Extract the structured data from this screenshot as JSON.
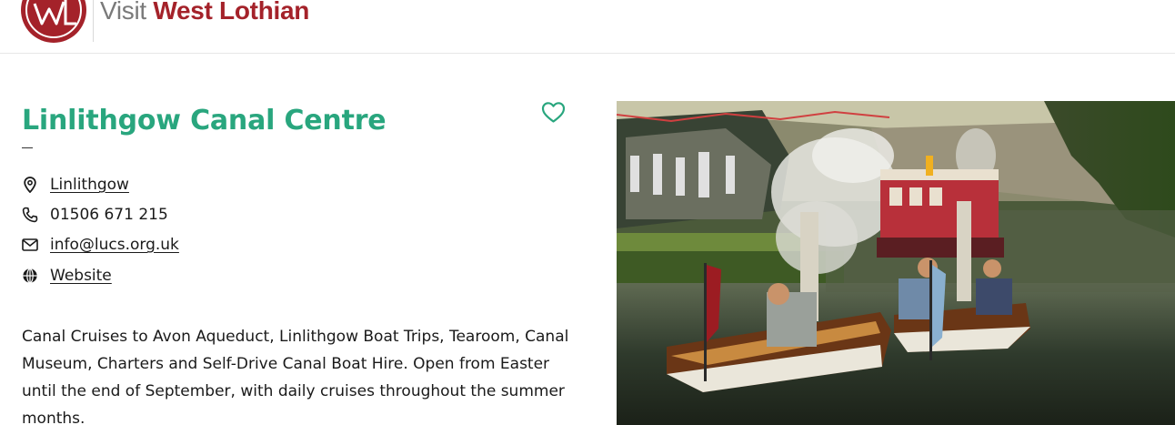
{
  "header": {
    "brand_visit": "Visit",
    "brand_name": "West Lothian",
    "logo_text": "WL"
  },
  "listing": {
    "title": "Linlithgow Canal Centre",
    "location": "Linlithgow",
    "phone": "01506 671 215",
    "email": "info@lucs.org.uk",
    "website": "Website",
    "description": "Canal Cruises to Avon Aqueduct, Linlithgow Boat Trips, Tearoom, Canal Museum, Charters and Self-Drive Canal Boat Hire. Open from Easter until the end of September, with daily cruises throughout the summer months."
  },
  "colors": {
    "accent_green": "#29a67e",
    "brand_red": "#a4222a"
  },
  "icons": {
    "favourite": "heart-outline-icon",
    "location": "map-pin-icon",
    "phone": "phone-icon",
    "email": "envelope-icon",
    "website": "globe-icon"
  }
}
